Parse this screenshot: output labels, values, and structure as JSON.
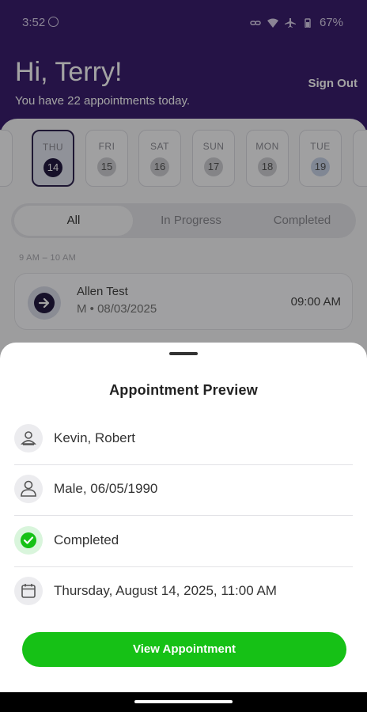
{
  "status_bar": {
    "time": "3:52",
    "battery": "67%",
    "icons": [
      "link-icon",
      "wifi-icon",
      "airplane-icon",
      "battery-icon"
    ]
  },
  "header": {
    "greeting": "Hi, Terry!",
    "subtitle": "You have 22 appointments today.",
    "sign_out": "Sign Out",
    "color": "#3b1f6e"
  },
  "days": [
    {
      "name": "THU",
      "date": "14",
      "active": true
    },
    {
      "name": "FRI",
      "date": "15"
    },
    {
      "name": "SAT",
      "date": "16"
    },
    {
      "name": "SUN",
      "date": "17"
    },
    {
      "name": "MON",
      "date": "18"
    },
    {
      "name": "TUE",
      "date": "19"
    }
  ],
  "filters": {
    "all": "All",
    "in_progress": "In Progress",
    "completed": "Completed",
    "selected": "All"
  },
  "timeslot": "9 AM – 10 AM",
  "appointment": {
    "name": "Allen Test",
    "meta": "M • 08/03/2025",
    "time": "09:00 AM"
  },
  "sheet": {
    "title": "Appointment Preview",
    "rows": [
      {
        "icon": "person-badge-icon",
        "text": "Kevin, Robert"
      },
      {
        "icon": "person-icon",
        "text": "Male, 06/05/1990"
      },
      {
        "icon": "check-circle-icon",
        "text": "Completed"
      },
      {
        "icon": "calendar-icon",
        "text": "Thursday, August 14, 2025, 11:00 AM"
      }
    ],
    "button": "View Appointment",
    "button_color": "#16c116"
  }
}
